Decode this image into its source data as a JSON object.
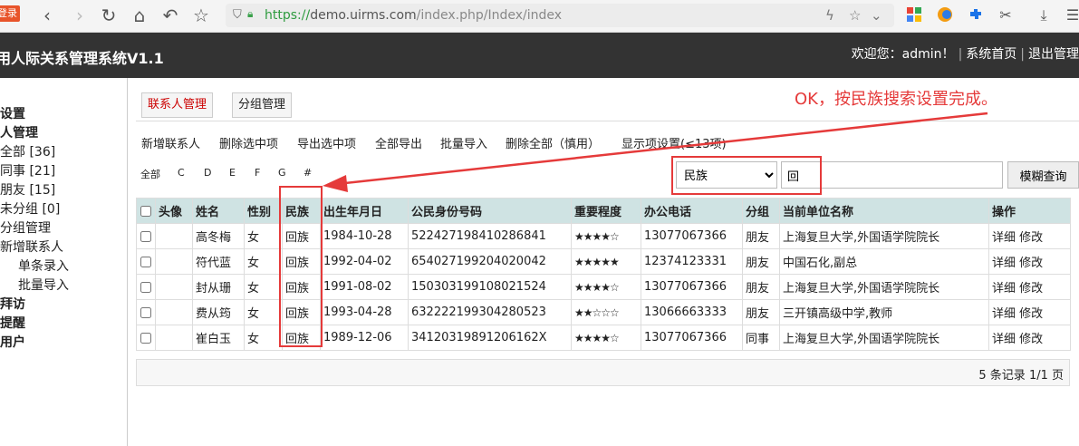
{
  "browser": {
    "login_badge": "登录",
    "url_scheme": "https://",
    "url_host": "demo.uirms.com",
    "url_path": "/index.php/Index/index"
  },
  "header": {
    "title": "用人际关系管理系统V1.1",
    "welcome": "欢迎您：admin！",
    "home_link": "系统首页",
    "logout_link": "退出管理"
  },
  "sidebar": {
    "items": [
      {
        "label": "设置",
        "bold": true
      },
      {
        "label": "人管理",
        "bold": true
      },
      {
        "label": "全部 [36]"
      },
      {
        "label": "同事 [21]"
      },
      {
        "label": "朋友 [15]"
      },
      {
        "label": "未分组 [0]"
      },
      {
        "label": "分组管理"
      },
      {
        "label": "新增联系人"
      },
      {
        "label": "单条录入"
      },
      {
        "label": "批量导入"
      },
      {
        "label": "拜访",
        "bold": true
      },
      {
        "label": "提醒",
        "bold": true
      },
      {
        "label": "用户",
        "bold": true
      }
    ]
  },
  "tabs": [
    {
      "label": "联系人管理",
      "active": true
    },
    {
      "label": "分组管理",
      "active": false
    }
  ],
  "toolbar": {
    "add": "新增联系人",
    "delete_selected": "删除选中项",
    "export_selected": "导出选中项",
    "export_all": "全部导出",
    "bulk_import": "批量导入",
    "delete_all": "删除全部（慎用）",
    "display_settings": "显示项设置(≤13项)"
  },
  "letters": [
    "全部",
    "C",
    "D",
    "E",
    "F",
    "G",
    "#"
  ],
  "search": {
    "field_selected": "民族",
    "value": "回",
    "button": "模糊查询"
  },
  "table": {
    "headers": [
      "头像",
      "姓名",
      "性别",
      "民族",
      "出生年月日",
      "公民身份号码",
      "重要程度",
      "办公电话",
      "分组",
      "当前单位名称",
      "操作"
    ],
    "rows": [
      {
        "name": "高冬梅",
        "gender": "女",
        "ethnicity": "回族",
        "birth": "1984-10-28",
        "id": "522427198410286841",
        "stars": "★★★★☆",
        "phone": "13077067366",
        "group": "朋友",
        "org": "上海复旦大学,外国语学院院长",
        "detail": "详细",
        "edit": "修改"
      },
      {
        "name": "符代蓝",
        "gender": "女",
        "ethnicity": "回族",
        "birth": "1992-04-02",
        "id": "654027199204020042",
        "stars": "★★★★★",
        "phone": "12374123331",
        "group": "朋友",
        "org": "中国石化,副总",
        "detail": "详细",
        "edit": "修改"
      },
      {
        "name": "封从珊",
        "gender": "女",
        "ethnicity": "回族",
        "birth": "1991-08-02",
        "id": "150303199108021524",
        "stars": "★★★★☆",
        "phone": "13077067366",
        "group": "朋友",
        "org": "上海复旦大学,外国语学院院长",
        "detail": "详细",
        "edit": "修改"
      },
      {
        "name": "费从筠",
        "gender": "女",
        "ethnicity": "回族",
        "birth": "1993-04-28",
        "id": "632222199304280523",
        "stars": "★★☆☆☆",
        "phone": "13066663333",
        "group": "朋友",
        "org": "三开镇高级中学,教师",
        "detail": "详细",
        "edit": "修改"
      },
      {
        "name": "崔白玉",
        "gender": "女",
        "ethnicity": "回族",
        "birth": "1989-12-06",
        "id": "34120319891206162X",
        "stars": "★★★★☆",
        "phone": "13077067366",
        "group": "同事",
        "org": "上海复旦大学,外国语学院院长",
        "detail": "详细",
        "edit": "修改"
      }
    ]
  },
  "footer": {
    "records": "5 条记录 1/1 页"
  },
  "annotation": {
    "note": "OK，按民族搜索设置完成。",
    "color": "#e53a3a"
  }
}
